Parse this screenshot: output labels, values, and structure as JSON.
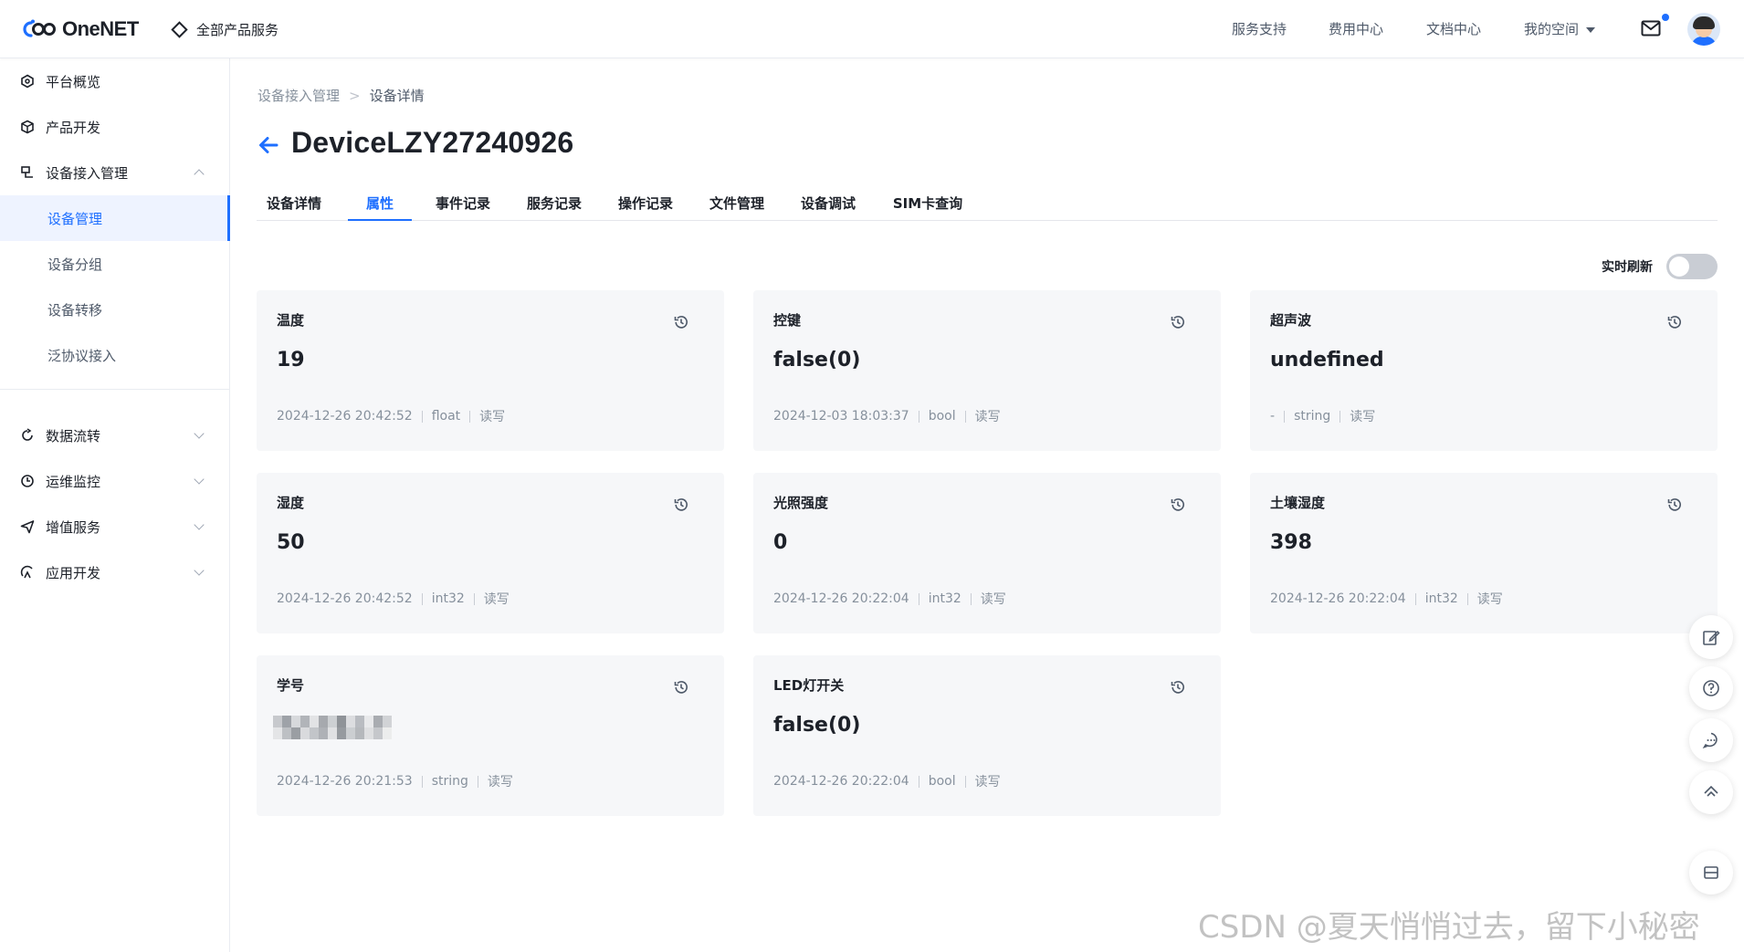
{
  "header": {
    "brand": "OneNET",
    "all_products": "全部产品服务",
    "nav": [
      "服务支持",
      "费用中心",
      "文档中心",
      "我的空间"
    ]
  },
  "sidebar": {
    "items": [
      {
        "label": "平台概览",
        "icon": "overview-icon"
      },
      {
        "label": "产品开发",
        "icon": "cube-icon"
      },
      {
        "label": "设备接入管理",
        "icon": "device-access-icon",
        "expanded": true
      },
      {
        "label": "数据流转",
        "icon": "data-flow-icon"
      },
      {
        "label": "运维监控",
        "icon": "monitor-icon"
      },
      {
        "label": "增值服务",
        "icon": "send-icon"
      },
      {
        "label": "应用开发",
        "icon": "app-dev-icon"
      }
    ],
    "sub_items": [
      "设备管理",
      "设备分组",
      "设备转移",
      "泛协议接入"
    ],
    "active_sub": "设备管理"
  },
  "breadcrumb": [
    "设备接入管理",
    "设备详情"
  ],
  "breadcrumb_sep": ">",
  "device_title": "DeviceLZY27240926",
  "tabs": [
    "设备详情",
    "属性",
    "事件记录",
    "服务记录",
    "操作记录",
    "文件管理",
    "设备调试",
    "SIM卡查询"
  ],
  "active_tab": "属性",
  "realtime_label": "实时刷新",
  "realtime_on": false,
  "properties": [
    {
      "name": "温度",
      "value": "19",
      "time": "2024-12-26 20:42:52",
      "type": "float",
      "access": "读写"
    },
    {
      "name": "控键",
      "value": "false(0)",
      "time": "2024-12-03 18:03:37",
      "type": "bool",
      "access": "读写"
    },
    {
      "name": "超声波",
      "value": "undefined",
      "time": "-",
      "type": "string",
      "access": "读写"
    },
    {
      "name": "湿度",
      "value": "50",
      "time": "2024-12-26 20:42:52",
      "type": "int32",
      "access": "读写"
    },
    {
      "name": "光照强度",
      "value": "0",
      "time": "2024-12-26 20:22:04",
      "type": "int32",
      "access": "读写"
    },
    {
      "name": "土壤湿度",
      "value": "398",
      "time": "2024-12-26 20:22:04",
      "type": "int32",
      "access": "读写"
    },
    {
      "name": "学号",
      "value": "",
      "time": "2024-12-26 20:21:53",
      "type": "string",
      "access": "读写",
      "blurred": true
    },
    {
      "name": "LED灯开关",
      "value": "false(0)",
      "time": "2024-12-26 20:22:04",
      "type": "bool",
      "access": "读写"
    }
  ],
  "fab_icons": [
    "edit-icon",
    "help-icon",
    "chat-icon",
    "top-icon",
    "collapse-icon"
  ],
  "watermark": "CSDN @夏天悄悄过去，留下小秘密",
  "colors": {
    "accent": "#1e6fff",
    "card_bg": "#f6f7f9",
    "muted": "#86909c"
  }
}
